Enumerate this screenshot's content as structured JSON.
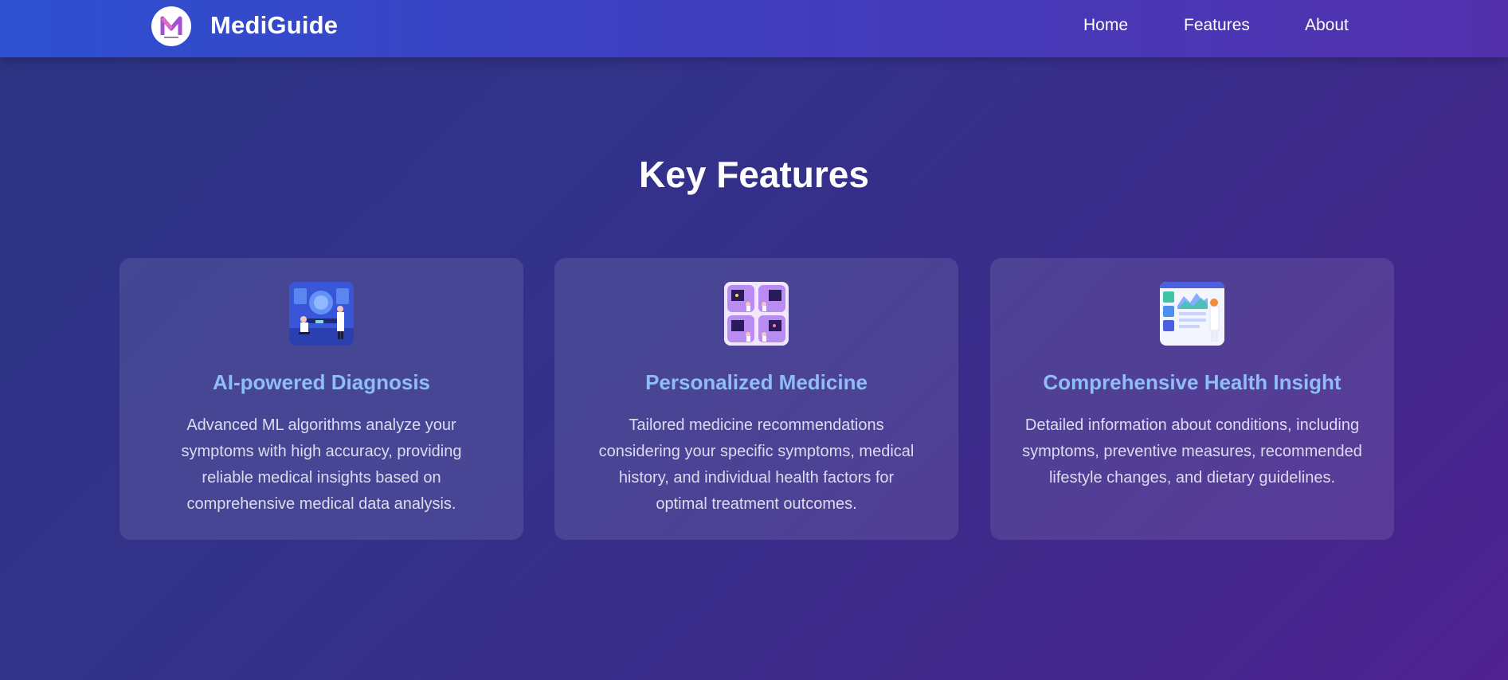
{
  "navbar": {
    "brand": "MediGuide",
    "logo_icon": "m-logo-icon",
    "links": [
      {
        "label": "Home"
      },
      {
        "label": "Features"
      },
      {
        "label": "About"
      }
    ]
  },
  "features": {
    "title": "Key Features",
    "cards": [
      {
        "icon": "ai-diagnosis-illustration",
        "title": "AI-powered Diagnosis",
        "text": "Advanced ML algorithms analyze your symptoms with high accuracy, providing reliable medical insights based on comprehensive medical data analysis."
      },
      {
        "icon": "personalized-medicine-illustration",
        "title": "Personalized Medicine",
        "text": "Tailored medicine recommendations considering your specific symptoms, medical history, and individual health factors for optimal treatment outcomes."
      },
      {
        "icon": "health-insight-illustration",
        "title": "Comprehensive Health Insight",
        "text": "Detailed information about conditions, including symptoms, preventive measures, recommended lifestyle changes, and dietary guidelines."
      }
    ]
  },
  "colors": {
    "accent_title": "#8fbdf5",
    "navbar_start": "#2d50d0",
    "navbar_end": "#5230ac"
  }
}
